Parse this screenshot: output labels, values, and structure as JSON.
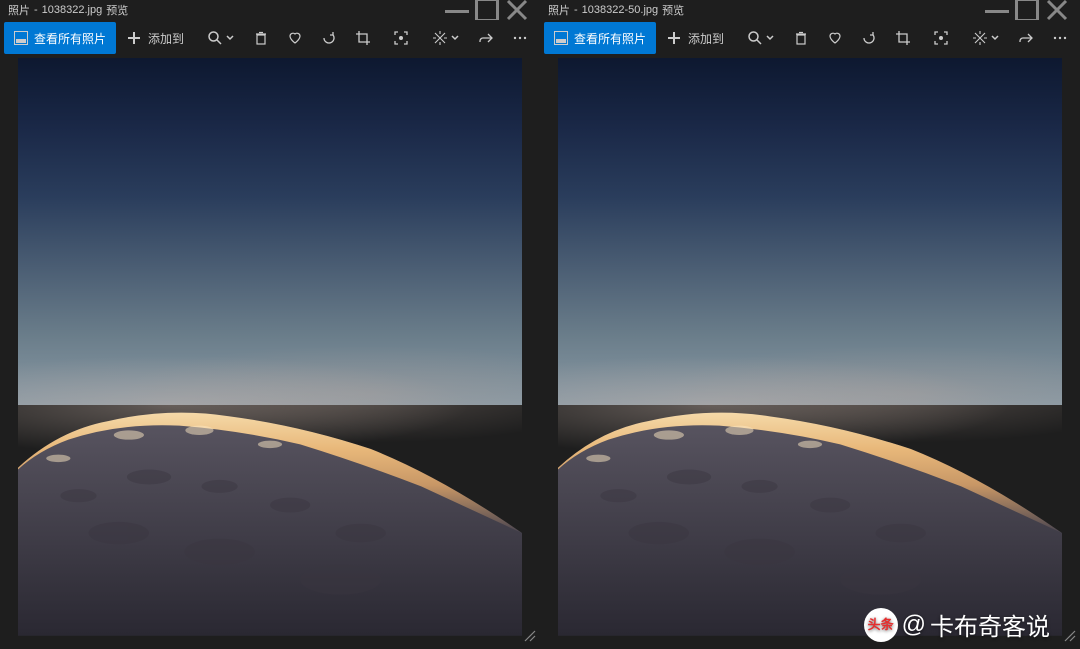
{
  "windows": [
    {
      "app": "照片",
      "filename": "1038322.jpg",
      "suffix": "预览"
    },
    {
      "app": "照片",
      "filename": "1038322-50.jpg",
      "suffix": "预览"
    }
  ],
  "toolbar": {
    "view_all": "查看所有照片",
    "add_to": "添加到"
  },
  "watermark": {
    "logo": "头条",
    "at": "@",
    "name": "卡布奇客说"
  }
}
